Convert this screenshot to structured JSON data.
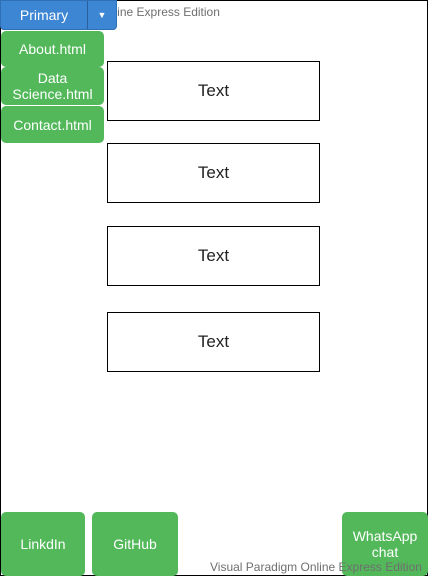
{
  "watermark": "Visual Paradigm Online Express Edition",
  "dropdown": {
    "label": "Primary",
    "caret": "▼"
  },
  "menu": {
    "items": [
      {
        "label": "About.html"
      },
      {
        "label": "Data Science.html"
      },
      {
        "label": "Contact.html"
      }
    ]
  },
  "content": {
    "boxes": [
      {
        "text": "Text"
      },
      {
        "text": "Text"
      },
      {
        "text": "Text"
      },
      {
        "text": "Text"
      }
    ]
  },
  "footer": {
    "linkedin": "LinkdIn",
    "github": "GitHub",
    "whatsapp": "WhatsApp chat"
  },
  "colors": {
    "primary_blue": "#3d86d3",
    "success_green": "#52b85a",
    "watermark_gray": "#6f6f6f"
  }
}
